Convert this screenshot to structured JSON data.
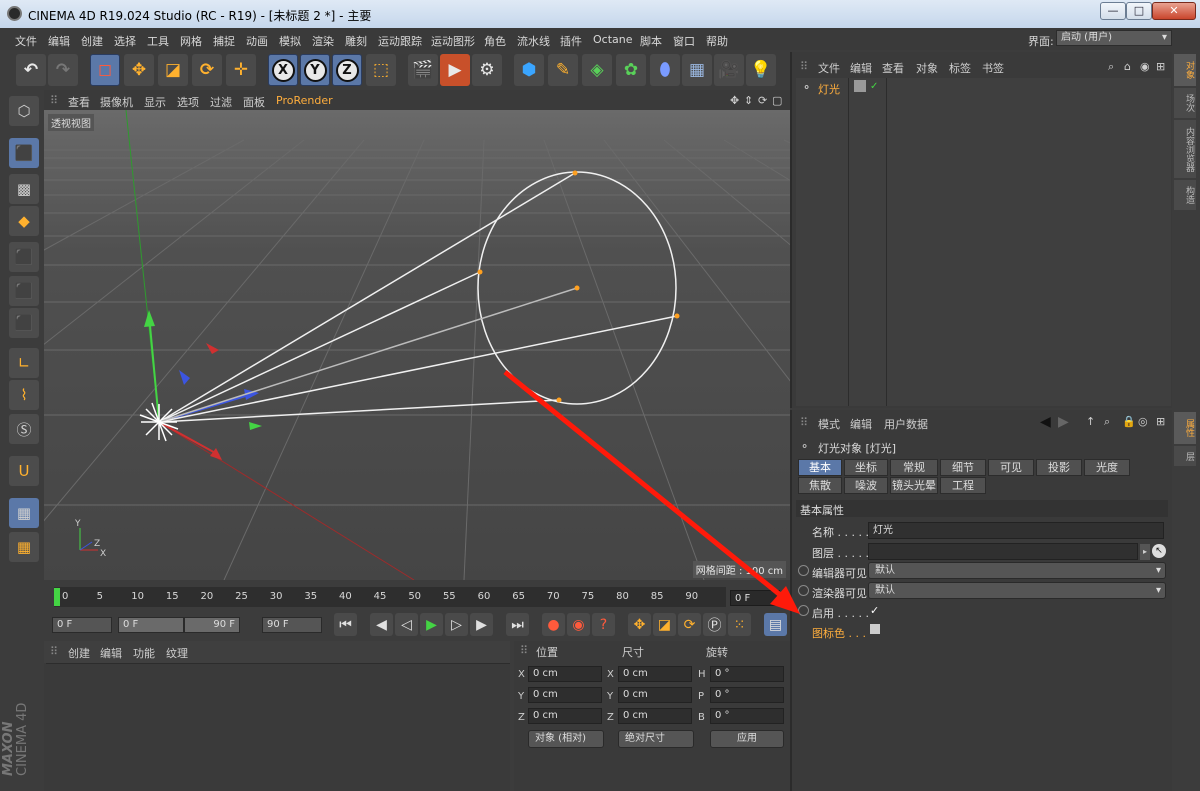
{
  "window": {
    "title": "CINEMA 4D R19.024 Studio (RC - R19) - [未标题 2 *] - 主要"
  },
  "window_controls": {
    "minimize": "—",
    "maximize": "□",
    "close": "✕"
  },
  "menu": [
    "文件",
    "编辑",
    "创建",
    "选择",
    "工具",
    "网格",
    "捕捉",
    "动画",
    "模拟",
    "渲染",
    "雕刻",
    "运动跟踪",
    "运动图形",
    "角色",
    "流水线",
    "插件",
    "Octane",
    "脚本",
    "窗口",
    "帮助"
  ],
  "layout": {
    "label": "界面:",
    "value": "启动 (用户)"
  },
  "toolbar": {
    "axis_x": "X",
    "axis_y": "Y",
    "axis_z": "Z",
    "icons": [
      "undo-icon",
      "redo-icon",
      "live-select-icon",
      "move-icon",
      "scale-icon",
      "rotate-icon",
      "transform-icon",
      "world-coordinates-icon",
      "render-view-icon",
      "render-to-picture-viewer-icon",
      "render-settings-icon",
      "cube-icon",
      "pen-icon",
      "subdivision-icon",
      "cloner-icon",
      "deformer-icon",
      "floor-icon",
      "camera-icon",
      "light-icon"
    ]
  },
  "viewport": {
    "menu": [
      "查看",
      "摄像机",
      "显示",
      "选项",
      "过滤",
      "面板",
      "ProRender"
    ],
    "label": "透视视图",
    "grid_info": "网格间距 : 100 cm",
    "axis_labels": {
      "x": "X",
      "y": "Y",
      "z": "Z"
    }
  },
  "timeline": {
    "ticks": [
      "0",
      "5",
      "10",
      "15",
      "20",
      "25",
      "30",
      "35",
      "40",
      "45",
      "50",
      "55",
      "60",
      "65",
      "70",
      "75",
      "80",
      "85",
      "90"
    ],
    "current_frame": "0 F",
    "start": "0 F",
    "min": "0 F",
    "max": "90 F",
    "end": "90 F"
  },
  "material_panel": {
    "menu": [
      "创建",
      "编辑",
      "功能",
      "纹理"
    ]
  },
  "coord_panel": {
    "headers": {
      "position": "位置",
      "size": "尺寸",
      "rotation": "旋转"
    },
    "rows": [
      {
        "axis": "X",
        "pos": "0 cm",
        "size_axis": "X",
        "size": "0 cm",
        "rot_axis": "H",
        "rot": "0 °"
      },
      {
        "axis": "Y",
        "pos": "0 cm",
        "size_axis": "Y",
        "size": "0 cm",
        "rot_axis": "P",
        "rot": "0 °"
      },
      {
        "axis": "Z",
        "pos": "0 cm",
        "size_axis": "Z",
        "size": "0 cm",
        "rot_axis": "B",
        "rot": "0 °"
      }
    ],
    "mode": "对象 (相对)",
    "size_mode": "绝对尺寸",
    "apply": "应用"
  },
  "object_manager": {
    "menu": [
      "文件",
      "编辑",
      "查看",
      "对象",
      "标签",
      "书签"
    ],
    "objects": [
      {
        "name": "灯光"
      }
    ]
  },
  "attribute_manager": {
    "menu": [
      "模式",
      "编辑",
      "用户数据"
    ],
    "object_title": "灯光对象 [灯光]",
    "tabs_row1": [
      "基本",
      "坐标",
      "常规",
      "细节",
      "可见",
      "投影",
      "光度"
    ],
    "tabs_row2": [
      "焦散",
      "噪波",
      "镜头光晕",
      "工程"
    ],
    "section": "基本属性",
    "fields": {
      "name_label": "名称 . . . . .",
      "name_value": "灯光",
      "layer_label": "图层 . . . . .",
      "layer_value": "",
      "editor_vis_label": "编辑器可见",
      "editor_vis_value": "默认",
      "render_vis_label": "渲染器可见",
      "render_vis_value": "默认",
      "enabled_label": "启用 . . . . .",
      "enabled_check": "✓",
      "icon_color_label": "图标色 . . ."
    }
  },
  "right_tabs": [
    "对象",
    "场次",
    "内容浏览器",
    "构造",
    "属性",
    "层"
  ],
  "brand": {
    "line1": "MAXON",
    "line2": "CINEMA 4D"
  },
  "colors": {
    "accent": "#5b78a8",
    "highlight": "#ffae3d",
    "annotation_arrow": "#ff1a0a"
  }
}
